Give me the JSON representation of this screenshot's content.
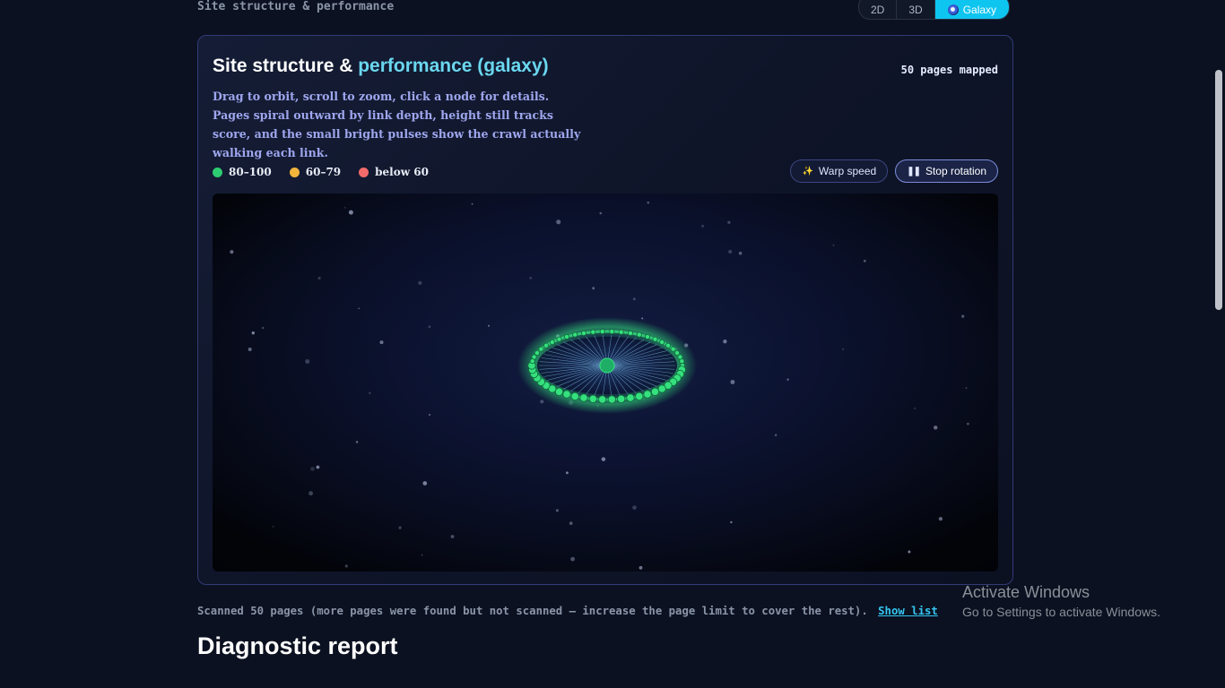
{
  "header": {
    "section_label": "Site structure & performance",
    "view_modes": [
      "2D",
      "3D",
      "Galaxy"
    ],
    "active_view": "Galaxy"
  },
  "card": {
    "title_main": "Site structure & ",
    "title_accent": "performance (galaxy)",
    "pages_mapped": "50 pages mapped",
    "description": "Drag to orbit, scroll to zoom, click a node for details. Pages spiral outward by link depth, height still tracks score, and the small bright pulses show the crawl actually walking each link.",
    "legend": [
      {
        "label": "80–100",
        "color": "#2ecc71"
      },
      {
        "label": "60–79",
        "color": "#f0b43c"
      },
      {
        "label": "below 60",
        "color": "#f26b6b"
      }
    ],
    "buttons": {
      "warp": "Warp speed",
      "stop": "Stop rotation"
    },
    "galaxy": {
      "node_color": "#35e07e",
      "page_count": 50
    }
  },
  "footer": {
    "scan_note": "Scanned 50 pages (more pages were found but not scanned — increase the page limit to cover the rest).",
    "show_list": "Show list",
    "report_title": "Diagnostic report"
  },
  "os_overlay": {
    "line1": "Activate Windows",
    "line2": "Go to Settings to activate Windows."
  },
  "colors": {
    "accent": "#0ec5f0",
    "link": "#35c6f2",
    "title_accent": "#6ad7ef"
  }
}
